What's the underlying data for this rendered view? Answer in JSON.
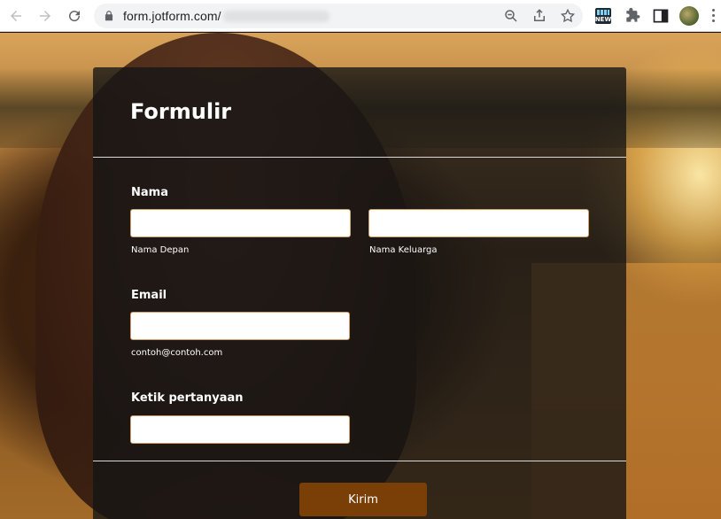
{
  "browser": {
    "url": "form.jotform.com/",
    "icons": {
      "back": "back-arrow-icon",
      "forward": "forward-arrow-icon",
      "reload": "reload-icon",
      "lock": "lock-icon",
      "zoom": "zoom-icon",
      "share": "share-icon",
      "bookmark": "star-icon",
      "extension": "new-badge-icon",
      "extensions": "puzzle-icon",
      "side_panel": "side-panel-icon",
      "menu": "kebab-menu-icon"
    },
    "extension_badge": "NEW"
  },
  "form": {
    "title": "Formulir",
    "name": {
      "label": "Nama",
      "first_sublabel": "Nama Depan",
      "last_sublabel": "Nama Keluarga",
      "first_value": "",
      "last_value": ""
    },
    "email": {
      "label": "Email",
      "sublabel": "contoh@contoh.com",
      "value": ""
    },
    "question": {
      "label": "Ketik pertanyaan",
      "value": ""
    },
    "submit_label": "Kirim"
  },
  "colors": {
    "card_bg": "rgba(20,20,20,0.78)",
    "input_border": "#d2a066",
    "submit_bg": "#7a3f06"
  }
}
